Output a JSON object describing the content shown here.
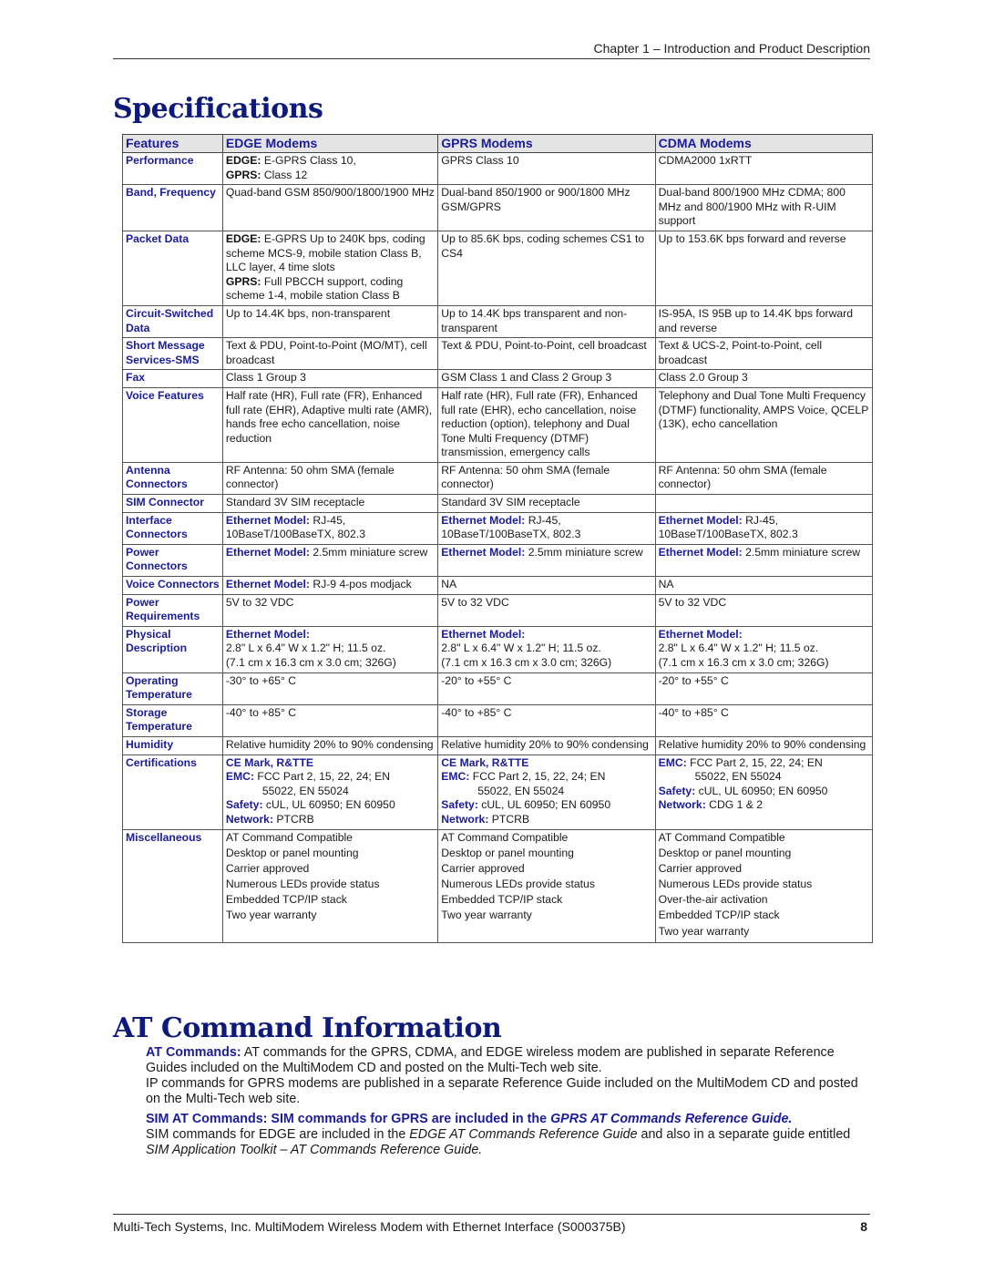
{
  "header": {
    "chapter": "Chapter 1 – Introduction and Product Description"
  },
  "specs": {
    "title": "Specifications",
    "columns": [
      "Features",
      "EDGE Modems",
      "GPRS Modems",
      "CDMA Modems"
    ],
    "rows": {
      "performance": {
        "feature": "Performance",
        "edge": {
          "l1_label": "EDGE:",
          "l1_text": " E-GPRS Class 10,",
          "l2_label": "GPRS:",
          "l2_text": " Class 12"
        },
        "gprs": "GPRS Class 10",
        "cdma": "CDMA2000 1xRTT"
      },
      "band": {
        "feature": "Band, Frequency",
        "edge": "Quad-band GSM 850/900/1800/1900 MHz",
        "gprs": "Dual-band 850/1900 or 900/1800 MHz GSM/GPRS",
        "cdma": "Dual-band 800/1900 MHz CDMA; 800 MHz and 800/1900 MHz with R-UIM support"
      },
      "packet": {
        "feature": "Packet Data",
        "edge": {
          "l1_label": "EDGE:",
          "l1_text": " E-GPRS Up to 240K bps, coding scheme MCS-9, mobile station Class B, LLC layer, 4 time slots",
          "l2_label": "GPRS:",
          "l2_text": " Full PBCCH support, coding scheme 1-4, mobile station Class B"
        },
        "gprs": "Up to 85.6K bps, coding schemes CS1 to CS4",
        "cdma": "Up to 153.6K bps forward and reverse"
      },
      "circuit": {
        "feature": "Circuit-Switched Data",
        "edge": "Up to 14.4K bps, non-transparent",
        "gprs": "Up to 14.4K bps transparent and non-transparent",
        "cdma": "IS-95A, IS 95B up to 14.4K bps forward and reverse"
      },
      "sms": {
        "feature": "Short Message Services-SMS",
        "edge": "Text & PDU, Point-to-Point (MO/MT), cell broadcast",
        "gprs": "Text & PDU, Point-to-Point, cell broadcast",
        "cdma": "Text & UCS-2, Point-to-Point, cell broadcast"
      },
      "fax": {
        "feature": "Fax",
        "edge": "Class 1 Group 3",
        "gprs": "GSM Class 1 and Class 2 Group 3",
        "cdma": "Class 2.0 Group 3"
      },
      "voice_features": {
        "feature": "Voice Features",
        "edge": "Half rate (HR), Full rate (FR), Enhanced full rate (EHR), Adaptive multi rate (AMR), hands free echo cancellation, noise reduction",
        "gprs": "Half rate (HR), Full rate (FR), Enhanced full rate (EHR), echo cancellation, noise reduction (option), telephony and Dual Tone Multi Frequency (DTMF) transmission, emergency calls",
        "cdma": "Telephony and Dual Tone Multi Frequency (DTMF) functionality, AMPS Voice, QCELP (13K), echo cancellation"
      },
      "antenna": {
        "feature": "Antenna Connectors",
        "edge": "RF Antenna: 50 ohm SMA (female connector)",
        "gprs": "RF Antenna: 50 ohm SMA (female connector)",
        "cdma": "RF Antenna: 50 ohm SMA (female connector)"
      },
      "sim": {
        "feature": "SIM Connector",
        "edge": "Standard 3V SIM receptacle",
        "gprs": "Standard 3V SIM receptacle",
        "cdma": ""
      },
      "interface": {
        "feature": "Interface Connectors",
        "label": "Ethernet Model:",
        "edge": " RJ-45, 10BaseT/100BaseTX, 802.3",
        "gprs": " RJ-45, 10BaseT/100BaseTX, 802.3",
        "cdma": " RJ-45, 10BaseT/100BaseTX, 802.3"
      },
      "power_conn": {
        "feature": "Power Connectors",
        "label": "Ethernet Model:",
        "edge": " 2.5mm miniature screw",
        "gprs": " 2.5mm miniature screw",
        "cdma": " 2.5mm miniature screw"
      },
      "voice_conn": {
        "feature": "Voice Connectors",
        "label": "Ethernet Model:",
        "edge": " RJ-9 4-pos modjack",
        "gprs": "NA",
        "cdma": "NA"
      },
      "power_req": {
        "feature": "Power Requirements",
        "edge": "5V to 32 VDC",
        "gprs": "5V to 32 VDC",
        "cdma": "5V to 32 VDC"
      },
      "physical": {
        "feature": "Physical Description",
        "label": "Ethernet Model:",
        "line1": "2.8\" L x 6.4\" W x 1.2\" H; 11.5 oz.",
        "line2": "(7.1 cm x 16.3 cm x 3.0 cm; 326G)"
      },
      "op_temp": {
        "feature": "Operating Temperature",
        "edge": "-30° to +65° C",
        "gprs": "-20° to +55° C",
        "cdma": "-20° to +55° C"
      },
      "st_temp": {
        "feature": "Storage Temperature",
        "edge": "-40° to +85° C",
        "gprs": "-40° to +85° C",
        "cdma": "-40° to +85° C"
      },
      "humidity": {
        "feature": "Humidity",
        "edge": "Relative humidity 20% to 90% condensing",
        "gprs": "Relative humidity 20% to 90% condensing",
        "cdma": "Relative humidity 20% to 90% condensing"
      },
      "cert": {
        "feature": "Certifications",
        "ce": "CE Mark, R&TTE",
        "emc_label": "EMC:",
        "emc_l1": " FCC Part 2, 15, 22, 24; EN",
        "emc_l2": "55022, EN 55024",
        "safety_label": "Safety:",
        "safety_text": " cUL, UL 60950; EN 60950",
        "network_label": "Network:",
        "network_gsm": " PTCRB",
        "network_cdma": " CDG 1 & 2"
      },
      "misc": {
        "feature": "Miscellaneous",
        "edge": [
          "AT Command Compatible",
          "Desktop or panel mounting",
          "Carrier approved",
          "Numerous LEDs provide status",
          "Embedded TCP/IP stack",
          "Two year warranty"
        ],
        "gprs": [
          "AT Command Compatible",
          "Desktop or panel mounting",
          "Carrier approved",
          "Numerous LEDs provide status",
          "Embedded TCP/IP stack",
          "Two year warranty"
        ],
        "cdma": [
          "AT Command Compatible",
          "Desktop or panel mounting",
          "Carrier approved",
          "Numerous LEDs provide status",
          "Over-the-air activation",
          "Embedded TCP/IP stack",
          "Two year warranty"
        ]
      }
    }
  },
  "at_info": {
    "title": "AT Command Information",
    "p1_label": "AT Commands:",
    "p1_text": " AT commands for the GPRS, CDMA, and EDGE wireless modem are published in separate Reference Guides included on the MultiModem CD and posted on the Multi-Tech web site.",
    "p2_text": "IP commands for GPRS modems are published in a separate Reference Guide included on the MultiModem CD and posted on the Multi-Tech web site.",
    "p3_label": "SIM AT Commands: SIM commands for GPRS are included in the ",
    "p3_italic": "GPRS AT Commands Reference Guide.",
    "p4_a": "SIM commands for EDGE are included in the ",
    "p4_italic1": "EDGE AT Commands Reference Guide",
    "p4_b": " and also in a separate guide entitled ",
    "p4_italic2": "SIM Application Toolkit – AT Commands Reference Guide."
  },
  "footer": {
    "text": "Multi-Tech Systems, Inc. MultiModem Wireless Modem with Ethernet Interface (S000375B)",
    "page_number": "8"
  }
}
